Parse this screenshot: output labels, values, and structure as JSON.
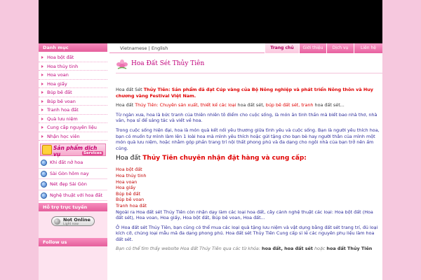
{
  "banner": {},
  "sidebar": {
    "categories_title": "Danh mục",
    "categories": [
      "Hoa bột đất",
      "Hoa thủy tinh",
      "Hoa voan",
      "Hoa giấy",
      "Búp bê đất",
      "Búp bê voan",
      "Tranh hoa đất",
      "Quà lưu niệm",
      "Cung cấp nguyên liệu",
      "Nhận học viên"
    ],
    "services_banner_title": "Sản phẩm dịch vụ",
    "services_banner_sub": "Services",
    "services": [
      "Khi đất nở hoa",
      "Sài Gòn hôm nay",
      "Nét đẹp Sài Gòn",
      "Nghệ thuật với hoa đất"
    ],
    "support_title": "Hỗ trợ trực tuyến",
    "online_status": "Not Online",
    "online_sub": "Light now",
    "follow_title": "Follow us"
  },
  "header": {
    "lang_vi": "Vietnamese",
    "lang_sep": "|",
    "lang_en": "English",
    "nav": [
      "Trang chủ",
      "Giới thiệu",
      "Dịch vụ",
      "Liên hệ"
    ],
    "active_nav": 0,
    "logo_text": "Hoa Đất Sét Thủy Tiên"
  },
  "content": {
    "p1_a": "Hoa đất Sét ",
    "p1_b": "Thủy Tiên: Sản phẩm đã đạt Cúp vàng của Bộ Nông nghiệp và phát triển Nông thôn và Huy chương vàng Festival Việt Nam.",
    "p2_a": "Hoa đất ",
    "p2_b": "Thủy Tiên: Chuyên sản xuất, thiết kế các loại",
    "p2_c": " hoa đất sét, ",
    "p2_d": "búp bê đất sét, tranh",
    "p2_e": " hoa đất sét...",
    "p3": "Từ ngàn xưa, hoa là bức tranh của thiên nhiên tô điểm cho cuộc sống, là món ăn tinh thần mà biết bao nhà thơ, nhà văn, họa sĩ để sáng tác và viết về hoa.",
    "p4": "Trong cuộc sống hiện đại, hoa là món quà kết nối yêu thương giữa tình yêu và cuộc sống. Bạn là người yêu thích hoa, bạn có muốn tự mình làm lên 1 loài hoa mà mình yêu thích hoặc gửi tặng cho bạn bè hay người thân của mình một món quà lưu niệm, hoặc nhằm góp phần trang trí nội thất phong phú và đa dạng cho ngôi nhà của bạn trở nên ấm cúng.",
    "heading_a": "Hoa đất ",
    "heading_b": "Thủy Tiên chuyên nhận đặt hàng và cung cấp:",
    "products": [
      "Hoa bột đất",
      "Hoa thủy tinh",
      "Hoa voan",
      "Hoa giấy",
      "Búp bê đất",
      "Búp bê voan",
      "Tranh hoa đất"
    ],
    "p5": "Ngoài ra Hoa đất sét Thủy Tiên còn nhận dạy làm các loại hoa đất, cây cảnh nghệ thuật các loại: Hoa bột đất (Hoa đất sét), Hoa voan, Hoa giấy, Hoa bột đất, Búp bê voan, Hoa đất...",
    "p6": "Ở Hoa đất sét Thủy Tiên, bạn cũng có thể mua các loại quà tặng lưu niệm và vật dụng bằng đất sét trang trí, đủ loại kích cỡ, chủng loại mẫu mã đa dạng phong phú. Hoa đất sét Thủy Tiên Cung cấp sỉ lẻ các nguyên phụ liệu làm hoa đất sét.",
    "p7_a": "Bạn có thể tìm thấy website Hoa đất Thủy Tiên qua các từ khóa: ",
    "p7_b": "hoa đất, hoa đất sét",
    "p7_c": " hoặc ",
    "p7_d": "hoa đất Thủy Tiên"
  },
  "colors": {
    "background": "#f6c8de",
    "accent": "#e55f9c",
    "link": "#c0007a",
    "highlight": "#e00000",
    "banner": "#000000"
  }
}
